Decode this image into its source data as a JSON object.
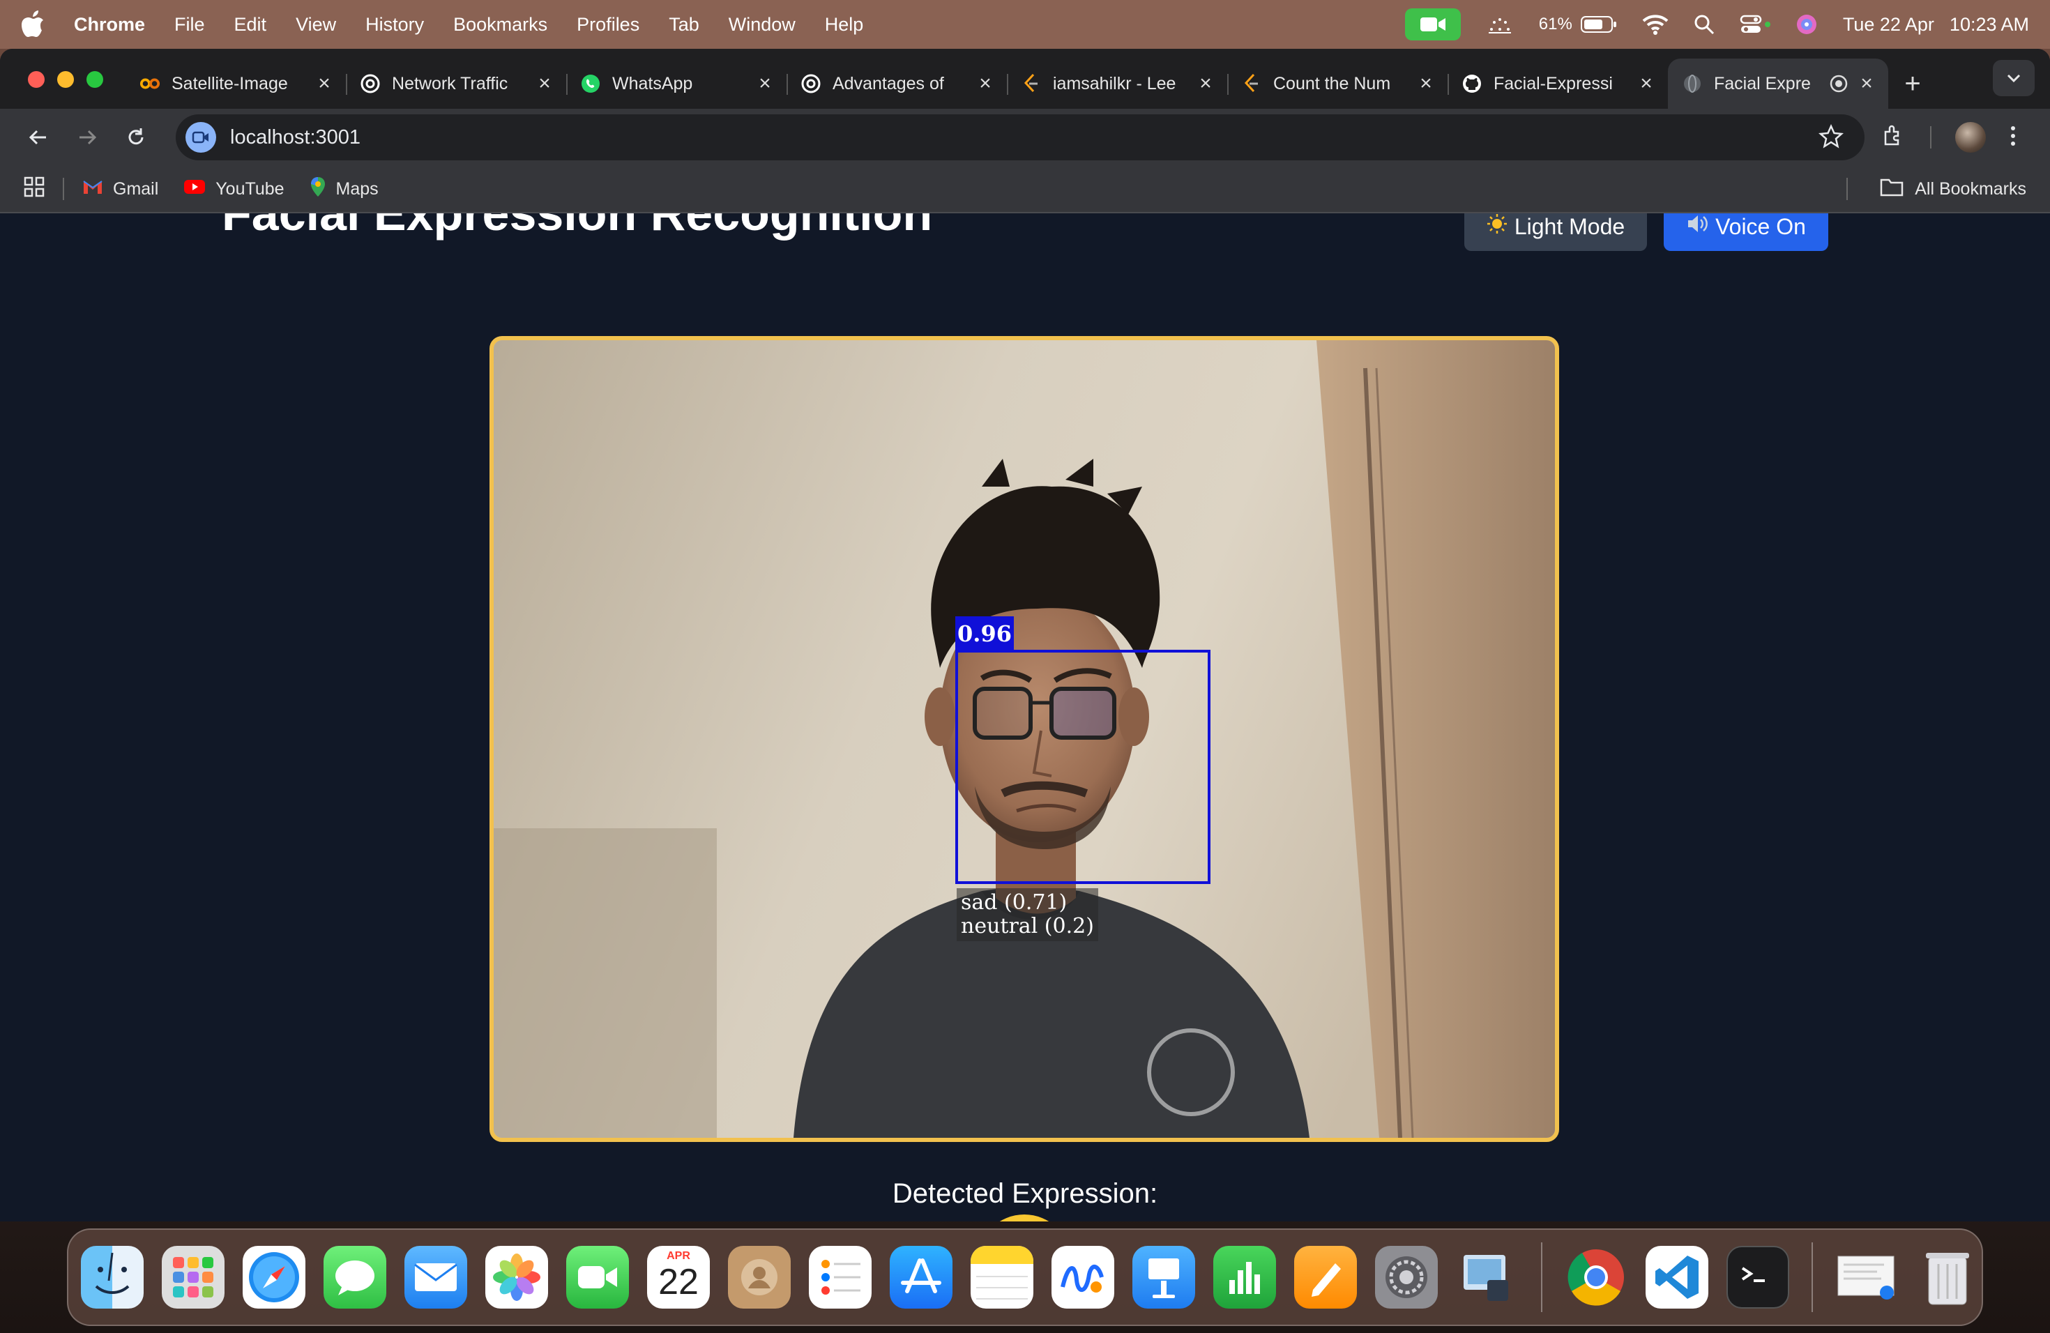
{
  "menubar": {
    "app_name": "Chrome",
    "items": [
      "File",
      "Edit",
      "View",
      "History",
      "Bookmarks",
      "Profiles",
      "Tab",
      "Window",
      "Help"
    ],
    "battery": "61%",
    "date": "Tue 22 Apr",
    "time": "10:23 AM"
  },
  "tabs": [
    {
      "title": "Satellite-Image",
      "icon": "colab-icon"
    },
    {
      "title": "Network Traffic",
      "icon": "openai-icon"
    },
    {
      "title": "WhatsApp",
      "icon": "whatsapp-icon"
    },
    {
      "title": "Advantages of",
      "icon": "openai-icon"
    },
    {
      "title": "iamsahilkr - Lee",
      "icon": "leetcode-icon"
    },
    {
      "title": "Count the Num",
      "icon": "leetcode-icon"
    },
    {
      "title": "Facial-Expressi",
      "icon": "github-icon"
    },
    {
      "title": "Facial Expre",
      "icon": "globe-icon",
      "active": true
    }
  ],
  "toolbar": {
    "url": "localhost:3001"
  },
  "bookmarks": {
    "items": [
      "Gmail",
      "YouTube",
      "Maps"
    ],
    "all_label": "All Bookmarks"
  },
  "app": {
    "title": "Facial Expression Recognition",
    "light_mode_label": "Light Mode",
    "voice_label": "Voice On",
    "detection": {
      "score": "0.96",
      "expressions": [
        "sad (0.71)",
        "neutral (0.2)"
      ]
    },
    "detected_label": "Detected Expression:",
    "emoji": "sad-face-emoji",
    "accent_color": "#f2c14e",
    "voice_button_color": "#2563eb",
    "box_color": "#1010d8"
  },
  "dock": {
    "calendar_month": "APR",
    "calendar_day": "22"
  }
}
